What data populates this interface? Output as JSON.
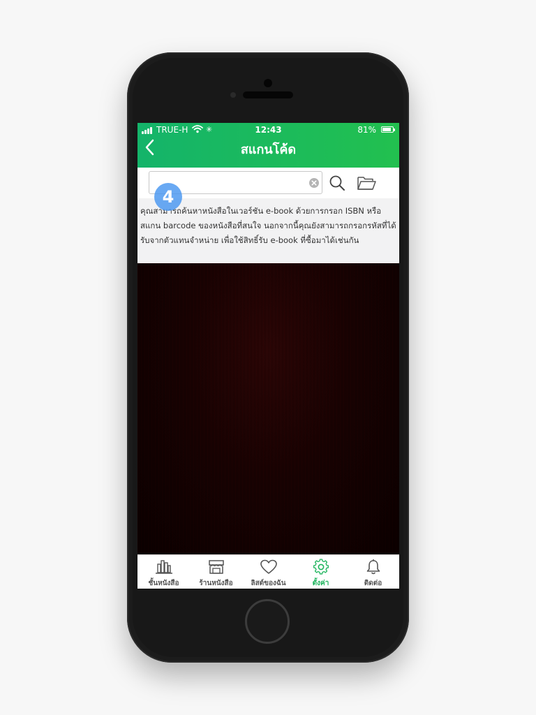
{
  "status_bar": {
    "carrier": "TRUE-H",
    "time": "12:43",
    "battery_percent": "81%",
    "battery_level": 0.81,
    "signal_bars": 4
  },
  "header": {
    "title": "สแกนโค้ด",
    "back_icon": "chevron-left-icon"
  },
  "search": {
    "value": "",
    "placeholder": "",
    "clear_icon": "clear-circle-icon",
    "search_icon": "magnifier-icon",
    "folder_icon": "folder-open-icon"
  },
  "description": "คุณสามารถค้นหาหนังสือในเวอร์ชัน e-book ด้วยการกรอก ISBN หรือ สแกน barcode ของหนังสือที่สนใจ นอกจากนี้คุณยังสามารถกรอกรหัสที่ได้รับจากตัวแทนจำหน่าย เพื่อใช้สิทธิ์รับ e-book ที่ซื้อมาได้เช่นกัน",
  "step_badge": "4",
  "tabs": [
    {
      "label": "ชั้นหนังสือ",
      "icon": "bookshelf-icon",
      "active": false
    },
    {
      "label": "ร้านหนังสือ",
      "icon": "store-icon",
      "active": false
    },
    {
      "label": "ลิสต์ของฉัน",
      "icon": "heart-icon",
      "active": false
    },
    {
      "label": "ตั้งค่า",
      "icon": "gear-icon",
      "active": true
    },
    {
      "label": "ติดต่อ",
      "icon": "bell-icon",
      "active": false
    }
  ],
  "colors": {
    "accent": "#1db45c",
    "header_gradient_start": "#14b46a",
    "header_gradient_end": "#22c04f",
    "badge": "#4896f0"
  }
}
